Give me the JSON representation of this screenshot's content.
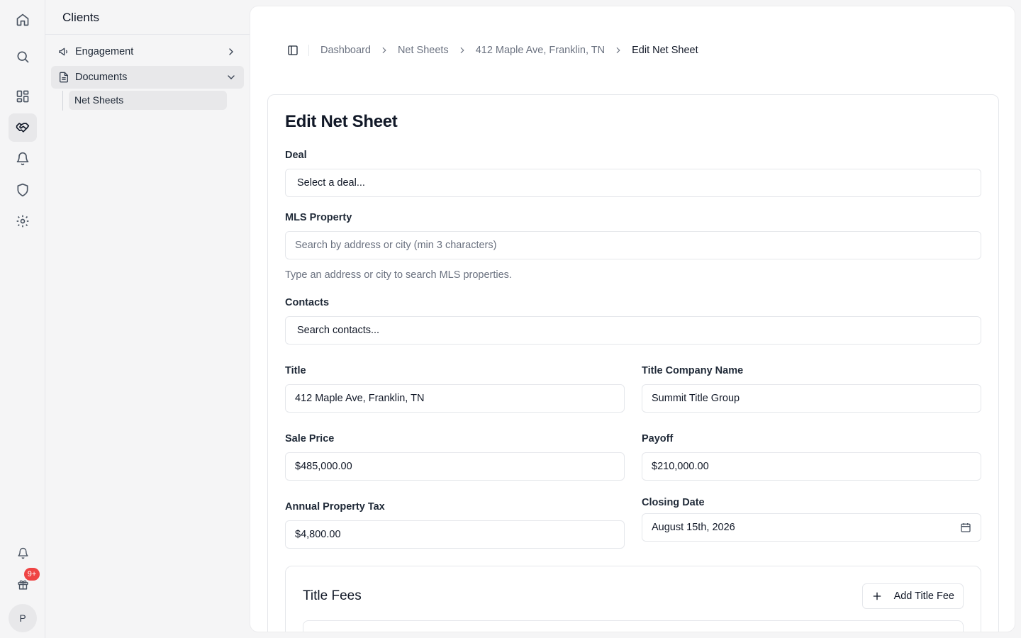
{
  "rail": {
    "icons": [
      "home-icon",
      "search-icon",
      "dashboard-icon",
      "handshake-icon",
      "bell-icon",
      "shield-icon",
      "gear-icon"
    ],
    "bottom_icons": [
      "bell-icon",
      "gift-icon"
    ],
    "badge": "9+",
    "avatar": "P"
  },
  "sidebar": {
    "title": "Clients",
    "items": [
      {
        "label": "Engagement",
        "icon": "megaphone-icon",
        "expanded": false
      },
      {
        "label": "Documents",
        "icon": "document-icon",
        "expanded": true
      }
    ],
    "sub_items": [
      {
        "label": "Net Sheets"
      }
    ]
  },
  "breadcrumb": {
    "items": [
      "Dashboard",
      "Net Sheets",
      "412 Maple Ave, Franklin, TN"
    ],
    "current": "Edit Net Sheet"
  },
  "form": {
    "title": "Edit Net Sheet",
    "deal": {
      "label": "Deal",
      "value": "Select a deal..."
    },
    "mls": {
      "label": "MLS Property",
      "placeholder": "Search by address or city (min 3 characters)",
      "hint": "Type an address or city to search MLS properties."
    },
    "contacts": {
      "label": "Contacts",
      "value": "Search contacts..."
    },
    "title_field": {
      "label": "Title",
      "value": "412 Maple Ave, Franklin, TN"
    },
    "title_company": {
      "label": "Title Company Name",
      "value": "Summit Title Group"
    },
    "sale_price": {
      "label": "Sale Price",
      "value": "$485,000.00"
    },
    "payoff": {
      "label": "Payoff",
      "value": "$210,000.00"
    },
    "property_tax": {
      "label": "Annual Property Tax",
      "value": "$4,800.00"
    },
    "closing_date": {
      "label": "Closing Date",
      "value": "August 15th, 2026"
    }
  },
  "title_fees": {
    "title": "Title Fees",
    "add_label": "Add Title Fee"
  }
}
